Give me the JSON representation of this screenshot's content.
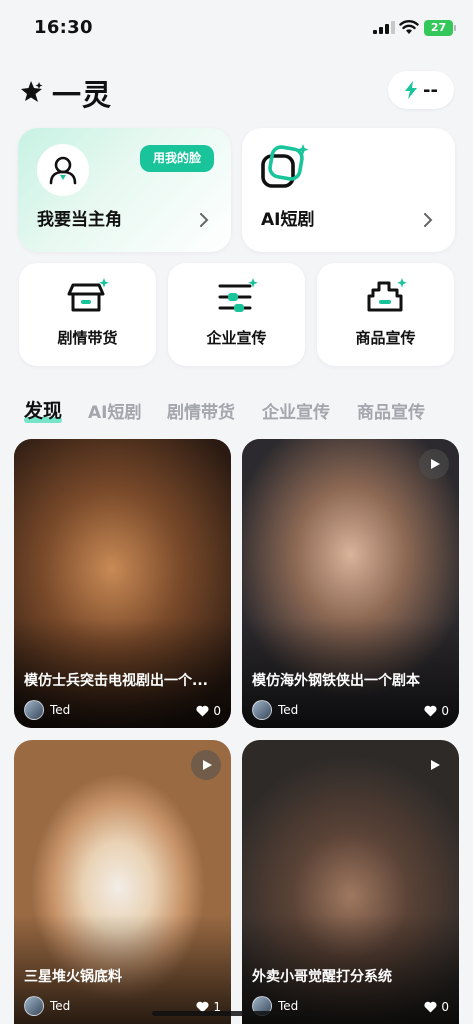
{
  "status": {
    "time": "16:30",
    "battery": "27"
  },
  "header": {
    "title": "一灵",
    "credits": "--"
  },
  "feature_cards": {
    "star": {
      "label": "我要当主角",
      "badge": "用我的脸"
    },
    "drama": {
      "label": "AI短剧"
    }
  },
  "small_cards": [
    {
      "label": "剧情带货",
      "icon": "store-icon"
    },
    {
      "label": "企业宣传",
      "icon": "sliders-icon"
    },
    {
      "label": "商品宣传",
      "icon": "product-icon"
    }
  ],
  "tabs": [
    "发现",
    "AI短剧",
    "剧情带货",
    "企业宣传",
    "商品宣传"
  ],
  "active_tab": "发现",
  "feed": [
    {
      "title": "模仿士兵突击电视剧出一个...",
      "author": "Ted",
      "likes": "0"
    },
    {
      "title": "模仿海外钢铁侠出一个剧本",
      "author": "Ted",
      "likes": "0"
    },
    {
      "title": "三星堆火锅底料",
      "author": "Ted",
      "likes": "1"
    },
    {
      "title": "外卖小哥觉醒打分系统",
      "author": "Ted",
      "likes": "0"
    }
  ],
  "colors": {
    "accent": "#19c49a",
    "tab_underline": "#5fe0c0",
    "background": "#f4f5f7"
  }
}
